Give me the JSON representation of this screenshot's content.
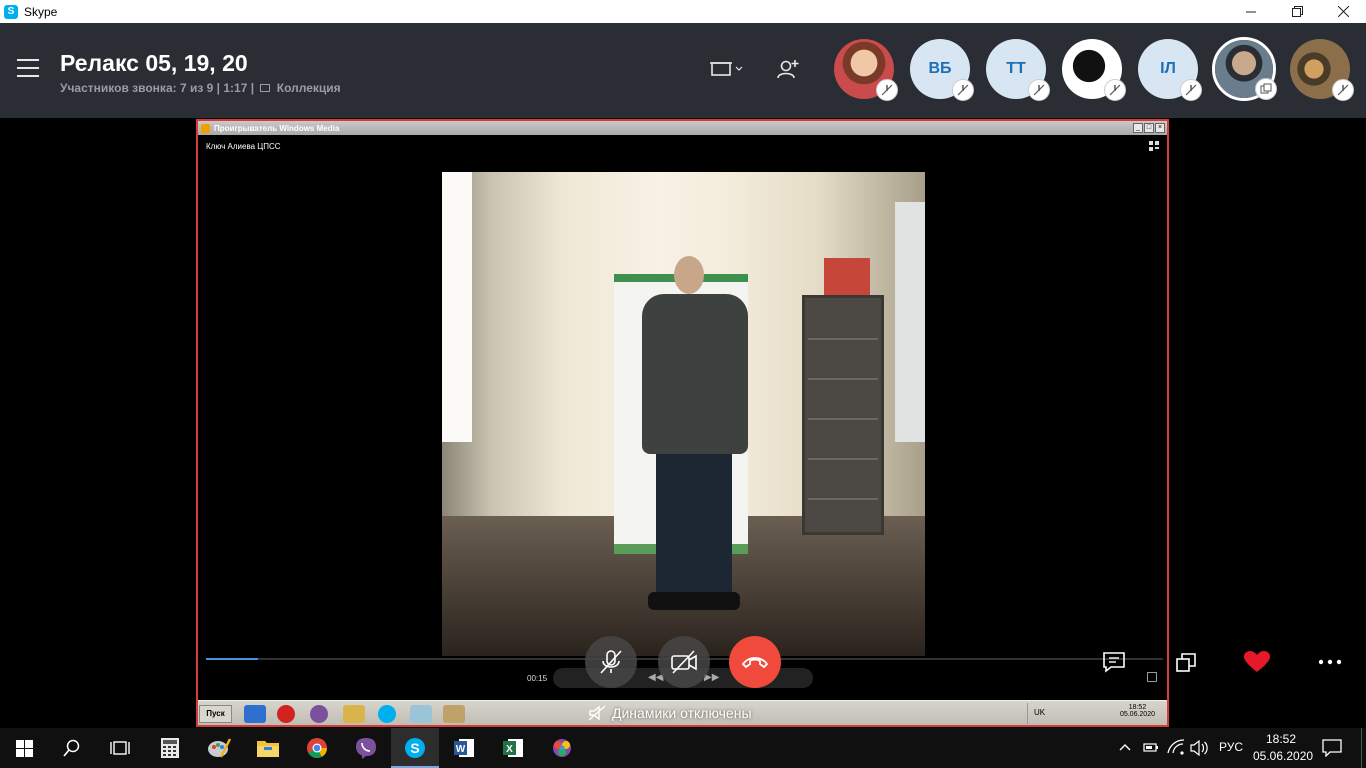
{
  "window": {
    "title": "Skype",
    "app_icon_letter": "S"
  },
  "call": {
    "title": "Релакс 05, 19, 20",
    "participants_text": "Участников звонка: 7 из 9",
    "duration": "1:17",
    "gallery_label": "Коллекция"
  },
  "participants": [
    {
      "initials": "",
      "kind": "photo",
      "color": "#b34848"
    },
    {
      "initials": "ВБ",
      "kind": "initials",
      "color": "#d8e6f4"
    },
    {
      "initials": "ТТ",
      "kind": "initials",
      "color": "#d8e6f4"
    },
    {
      "initials": "",
      "kind": "silhouette",
      "color": "#ffffff"
    },
    {
      "initials": "IЛ",
      "kind": "initials",
      "color": "#d8e6f4"
    },
    {
      "initials": "",
      "kind": "photo",
      "color": "#6a7d8c"
    },
    {
      "initials": "",
      "kind": "photo",
      "color": "#8a6f4a"
    }
  ],
  "wmp": {
    "title": "Проигрыватель Windows Media",
    "media_name": "Ключ Алиева ЦПСС",
    "time": "00:15",
    "start_label": "Пуск",
    "tray_lang": "UK",
    "tray_time": "18:52",
    "tray_date": "05.06.2020"
  },
  "notice": {
    "speakers_off": "Динамики отключены"
  },
  "taskbar": {
    "lang": "РУС",
    "time": "18:52",
    "date": "05.06.2020"
  },
  "colors": {
    "header_bg": "#2b2d35",
    "end_call": "#f04a3c",
    "heart": "#e8182b",
    "wmp_border": "#d83a3a"
  }
}
